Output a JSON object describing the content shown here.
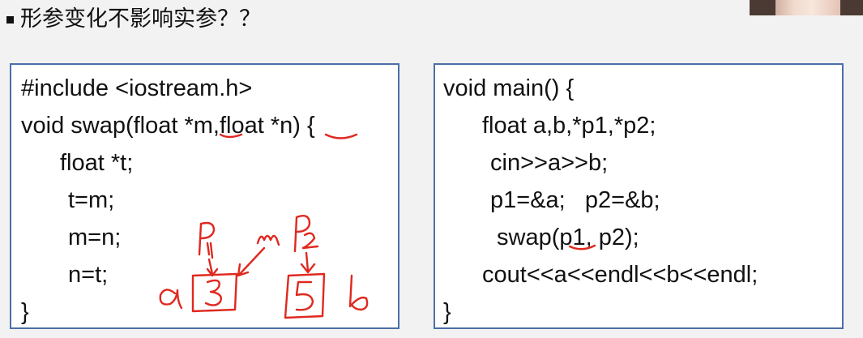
{
  "slide": {
    "heading": "形参变化不影响实参？？"
  },
  "left_code": {
    "lines": [
      "#include <iostream.h>",
      "void swap(float *m,float *n) {",
      "float *t;",
      "t=m;",
      "m=n;",
      "n=t;",
      "}"
    ]
  },
  "right_code": {
    "lines": [
      "void main() {",
      "float a,b,*p1,*p2;",
      "cin>>a>>b;",
      "p1=&a;   p2=&b;",
      "swap(p1, p2);",
      "cout<<a<<endl<<b<<endl;",
      "}"
    ]
  },
  "annotations": {
    "color": "#e0281f",
    "left_cell_label": "a",
    "left_cell_value": "3",
    "right_cell_label": "b",
    "right_cell_value": "5",
    "pointer_labels": [
      "p1",
      "m",
      "p2"
    ]
  },
  "colors": {
    "box_border": "#4a6fa8",
    "background": "#f2f2f2"
  }
}
